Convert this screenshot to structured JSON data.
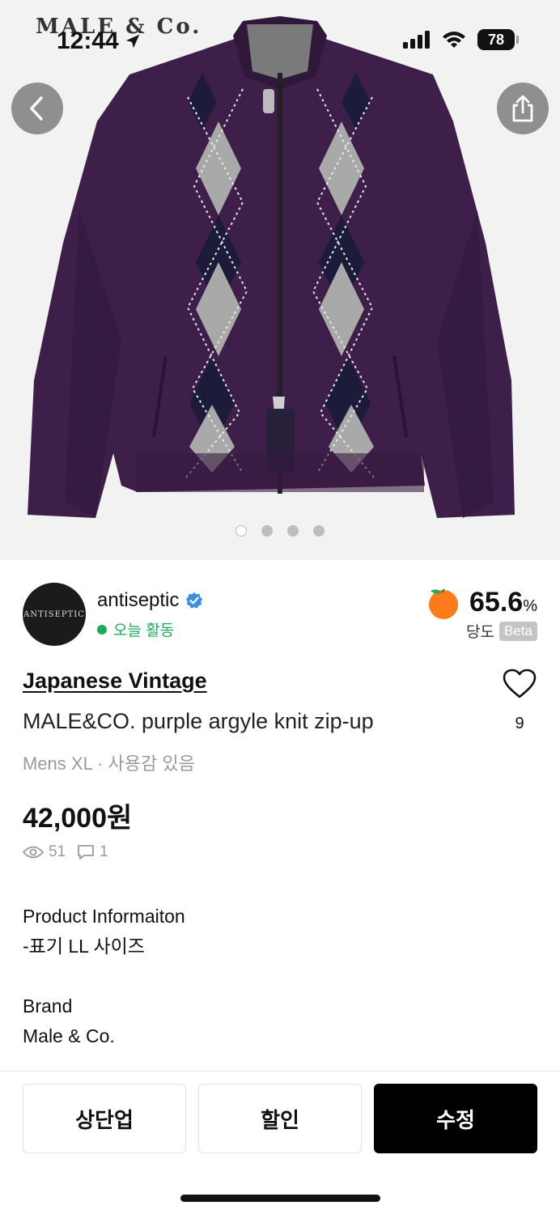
{
  "status": {
    "time": "12:44",
    "battery": "78"
  },
  "hero": {
    "brand_label": "MALE & Co.",
    "page_count": 4,
    "active_page": 1
  },
  "seller": {
    "avatar_text": "ANTISEPTIC",
    "name": "antiseptic",
    "activity": "오늘 활동",
    "score": "65.6",
    "score_unit": "%",
    "score_label": "당도",
    "beta": "Beta"
  },
  "product": {
    "category": "Japanese Vintage",
    "title": "MALE&CO. purple argyle knit zip-up",
    "meta": "Mens XL · 사용감 있음",
    "price": "42,000원",
    "likes": "9",
    "views": "51",
    "comments": "1"
  },
  "description": [
    "Product Informaiton",
    "-표기 LL 사이즈",
    "",
    "Brand",
    "Male & Co."
  ],
  "actions": {
    "bump": "상단업",
    "discount": "할인",
    "edit": "수정"
  },
  "colors": {
    "accent_green": "#1aab5c",
    "sweater": "#3d1f4a"
  }
}
